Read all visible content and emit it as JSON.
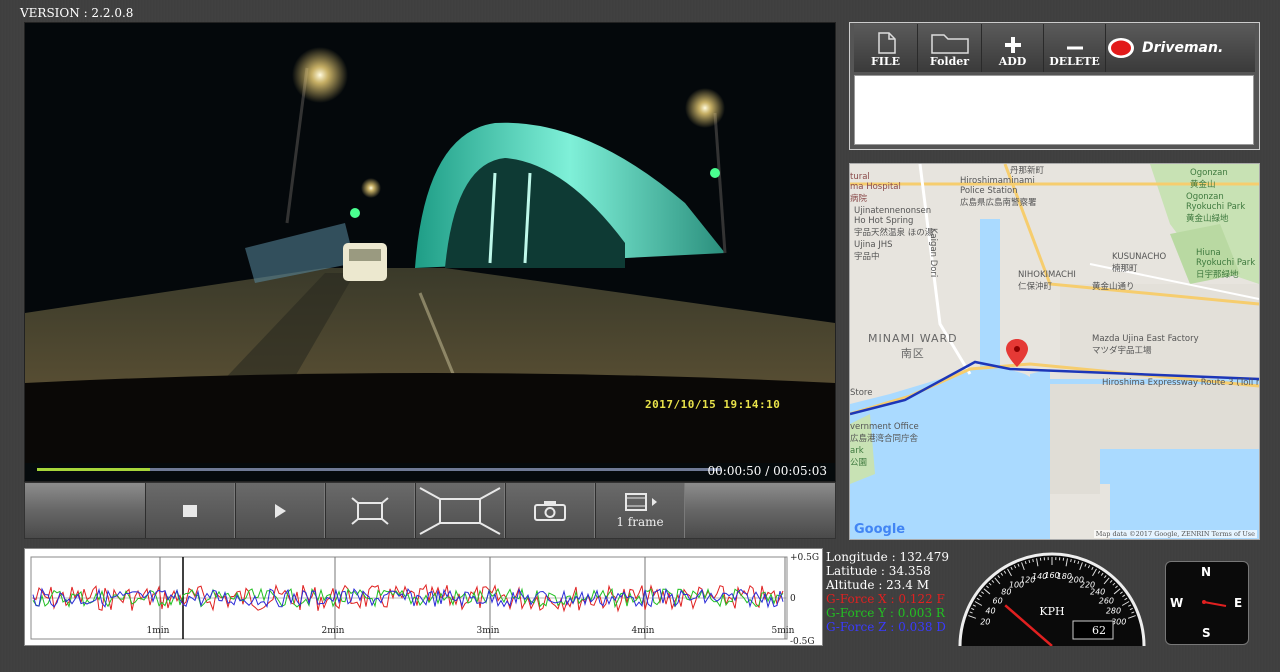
{
  "app": {
    "version": "VERSION : 2.2.0.8"
  },
  "video": {
    "timestamp": "2017/10/15 19:14:10",
    "time_readout": "00:00:50 / 00:05:03",
    "progress": 0.165
  },
  "controls": {
    "frame_step_label": "1 frame"
  },
  "toolbar": {
    "file_label": "FILE",
    "folder_label": "Folder",
    "add_label": "ADD",
    "delete_label": "DELETE",
    "brand": "Driveman."
  },
  "map": {
    "labels": {
      "hospital": "tural\nma Hospital\n病院",
      "police": "Hiroshimaminami\nPolice Station\n広島県広島南警察署",
      "onsen": "Ujinatennenonsen\nHo Hot Spring\n宇品天然温泉 ほの湯",
      "jhs": "Ujina JHS\n宇品中",
      "kaigan": "Kaigan Dori",
      "ogonzan": "Ogonzan\n黄金山",
      "ogonzan_park": "Ogonzan\nRyokuchi Park\n黄金山緑地",
      "kusunacho": "KUSUNACHO\n楠那町",
      "hiuna": "Hiuna\nRyokuchi Park\n日宇那緑地",
      "nihokimachi": "NIHOKIMACHI\n仁保沖町",
      "ogonzan_dori": "黄金山通り",
      "minami_ward": "MINAMI WARD\n南区",
      "mazda": "Mazda Ujina East Factory\nマツダ宇品工場",
      "expressway": "Hiroshima Expressway Route 3 (Toll ro",
      "store": "Store",
      "govt": "vernment Office\n広島港湾合同庁舎",
      "park": "ark\n公園",
      "tanbashin": "丹那新町"
    },
    "google": "Google",
    "attribution": "Map data ©2017 Google, ZENRIN   Terms of Use"
  },
  "gforce": {
    "x_ticks": [
      "1min",
      "2min",
      "3min",
      "4min",
      "5min"
    ],
    "y_ticks": [
      "+0.5G",
      "0",
      "-0.5G"
    ],
    "colors": {
      "x": "#e02020",
      "y": "#22c022",
      "z": "#2a2ad8"
    }
  },
  "info": {
    "longitude": "Longitude : 132.479",
    "latitude": "Latitude  : 34.358",
    "altitude": "Altitude  : 23.4 M",
    "gx": "G-Force X : 0.122 F",
    "gy": "G-Force Y : 0.003 R",
    "gz": "G-Force Z : 0.038 D"
  },
  "speedometer": {
    "unit": "KPH",
    "speed": "62",
    "ticks": [
      "20",
      "40",
      "60",
      "80",
      "100",
      "120",
      "140",
      "160",
      "180",
      "200",
      "220",
      "240",
      "260",
      "280",
      "300"
    ]
  },
  "compass": {
    "n": "N",
    "s": "S",
    "e": "E",
    "w": "W"
  }
}
